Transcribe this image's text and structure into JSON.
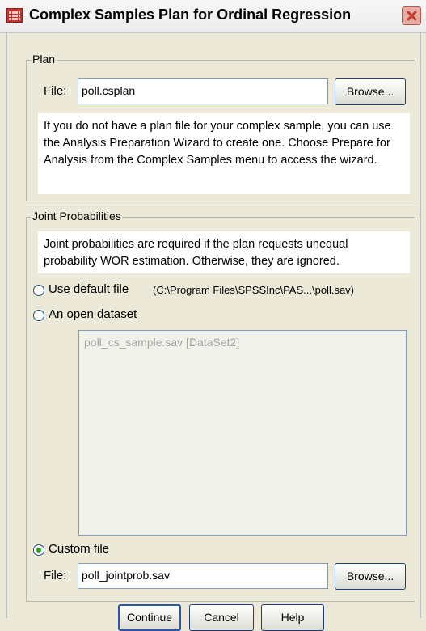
{
  "window": {
    "title": "Complex Samples Plan for Ordinal Regression"
  },
  "plan": {
    "group_label": "Plan",
    "file_label": "File:",
    "file_value": "poll.csplan",
    "browse_label": "Browse...",
    "info_text": "If you do not have a plan file for your complex sample, you can use the Analysis Preparation Wizard to create one. Choose Prepare for Analysis from the Complex Samples menu to access the wizard."
  },
  "joint": {
    "group_label": "Joint Probabilities",
    "info_text": "Joint probabilities are required if the plan requests unequal probability WOR estimation. Otherwise, they are ignored.",
    "options": {
      "default_file": {
        "label": "Use default file",
        "path": "(C:\\Program Files\\SPSSInc\\PAS...\\poll.sav)",
        "selected": false
      },
      "open_dataset": {
        "label": "An open dataset",
        "selected": false
      },
      "custom_file": {
        "label": "Custom file",
        "selected": true
      }
    },
    "datasets": [
      "poll_cs_sample.sav [DataSet2]"
    ],
    "custom_file_label": "File:",
    "custom_file_value": "poll_jointprob.sav",
    "browse_label": "Browse..."
  },
  "buttons": {
    "continue": "Continue",
    "cancel": "Cancel",
    "help": "Help"
  }
}
